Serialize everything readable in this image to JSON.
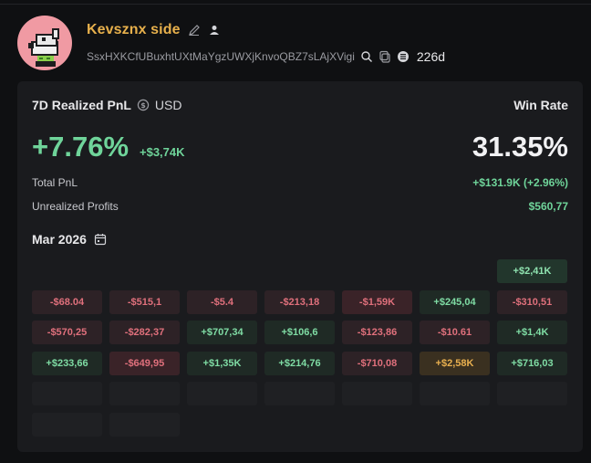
{
  "profile": {
    "name": "Kevsznx side",
    "address": "SsxHXKCfUBuxhtUXtMaYgzUWXjKnvoQBZ7sLAjXVigi",
    "age": "226d",
    "icons": [
      "edit-icon",
      "user-icon",
      "search-icon",
      "copy-icon",
      "solana-icon"
    ]
  },
  "card": {
    "title": "7D Realized PnL",
    "currency": "USD",
    "winrate_label": "Win Rate",
    "pnl_pct": "+7.76%",
    "pnl_abs": "+$3,74K",
    "winrate": "31.35%",
    "total_pnl_label": "Total PnL",
    "total_pnl_value": "+$131.9K (+2.96%)",
    "unrealized_label": "Unrealized Profits",
    "unrealized_value": "$560,77",
    "month": "Mar 2026"
  },
  "calendar": {
    "weeks": [
      [
        null,
        null,
        null,
        null,
        null,
        null,
        {
          "v": "+$2,41K",
          "t": "poss"
        }
      ],
      [
        {
          "v": "-$68.04",
          "t": "neg"
        },
        {
          "v": "-$515,1",
          "t": "neg"
        },
        {
          "v": "-$5.4",
          "t": "neg"
        },
        {
          "v": "-$213,18",
          "t": "neg"
        },
        {
          "v": "-$1,59K",
          "t": "negs"
        },
        {
          "v": "+$245,04",
          "t": "pos"
        },
        {
          "v": "-$310,51",
          "t": "neg"
        }
      ],
      [
        {
          "v": "-$570,25",
          "t": "neg"
        },
        {
          "v": "-$282,37",
          "t": "neg"
        },
        {
          "v": "+$707,34",
          "t": "pos"
        },
        {
          "v": "+$106,6",
          "t": "pos"
        },
        {
          "v": "-$123,86",
          "t": "neg"
        },
        {
          "v": "-$10.61",
          "t": "neg"
        },
        {
          "v": "+$1,4K",
          "t": "pos"
        }
      ],
      [
        {
          "v": "+$233,66",
          "t": "pos"
        },
        {
          "v": "-$649,95",
          "t": "negs"
        },
        {
          "v": "+$1,35K",
          "t": "pos"
        },
        {
          "v": "+$214,76",
          "t": "pos"
        },
        {
          "v": "-$710,08",
          "t": "neg"
        },
        {
          "v": "+$2,58K",
          "t": "gold"
        },
        {
          "v": "+$716,03",
          "t": "pos"
        }
      ],
      [
        {
          "v": "",
          "t": "empty"
        },
        {
          "v": "",
          "t": "empty"
        },
        {
          "v": "",
          "t": "empty"
        },
        {
          "v": "",
          "t": "empty"
        },
        {
          "v": "",
          "t": "empty"
        },
        {
          "v": "",
          "t": "empty"
        },
        {
          "v": "",
          "t": "empty"
        }
      ],
      [
        {
          "v": "",
          "t": "empty"
        },
        {
          "v": "",
          "t": "empty"
        },
        null,
        null,
        null,
        null,
        null
      ]
    ]
  },
  "colors": {
    "accent_name": "#e7b04c",
    "positive": "#6fd49a",
    "negative": "#e0707c",
    "avatar_bg": "#f09aa3"
  }
}
